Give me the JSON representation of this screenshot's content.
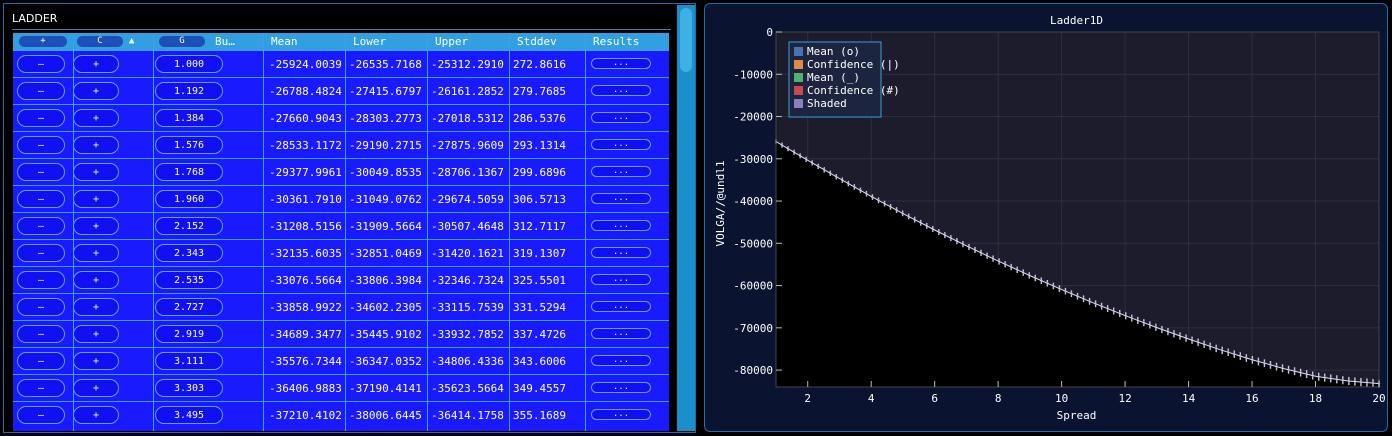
{
  "ladder": {
    "title": "LADDER",
    "header": {
      "plus_btn": "+",
      "c_btn": "C",
      "sort_arrow": "▲",
      "g_btn": "G",
      "bump_label": "Bu…",
      "columns": [
        "Mean",
        "Lower",
        "Upper",
        "Stddev",
        "Results"
      ]
    },
    "minus_label": "–",
    "plus_label": "+",
    "results_label": "...",
    "rows": [
      {
        "bump": "1.000",
        "mean": "-25924.0039",
        "lower": "-26535.7168",
        "upper": "-25312.2910",
        "stddev": "272.8616"
      },
      {
        "bump": "1.192",
        "mean": "-26788.4824",
        "lower": "-27415.6797",
        "upper": "-26161.2852",
        "stddev": "279.7685"
      },
      {
        "bump": "1.384",
        "mean": "-27660.9043",
        "lower": "-28303.2773",
        "upper": "-27018.5312",
        "stddev": "286.5376"
      },
      {
        "bump": "1.576",
        "mean": "-28533.1172",
        "lower": "-29190.2715",
        "upper": "-27875.9609",
        "stddev": "293.1314"
      },
      {
        "bump": "1.768",
        "mean": "-29377.9961",
        "lower": "-30049.8535",
        "upper": "-28706.1367",
        "stddev": "299.6896"
      },
      {
        "bump": "1.960",
        "mean": "-30361.7910",
        "lower": "-31049.0762",
        "upper": "-29674.5059",
        "stddev": "306.5713"
      },
      {
        "bump": "2.152",
        "mean": "-31208.5156",
        "lower": "-31909.5664",
        "upper": "-30507.4648",
        "stddev": "312.7117"
      },
      {
        "bump": "2.343",
        "mean": "-32135.6035",
        "lower": "-32851.0469",
        "upper": "-31420.1621",
        "stddev": "319.1307"
      },
      {
        "bump": "2.535",
        "mean": "-33076.5664",
        "lower": "-33806.3984",
        "upper": "-32346.7324",
        "stddev": "325.5501"
      },
      {
        "bump": "2.727",
        "mean": "-33858.9922",
        "lower": "-34602.2305",
        "upper": "-33115.7539",
        "stddev": "331.5294"
      },
      {
        "bump": "2.919",
        "mean": "-34689.3477",
        "lower": "-35445.9102",
        "upper": "-33932.7852",
        "stddev": "337.4726"
      },
      {
        "bump": "3.111",
        "mean": "-35576.7344",
        "lower": "-36347.0352",
        "upper": "-34806.4336",
        "stddev": "343.6006"
      },
      {
        "bump": "3.303",
        "mean": "-36406.9883",
        "lower": "-37190.4141",
        "upper": "-35623.5664",
        "stddev": "349.4557"
      },
      {
        "bump": "3.495",
        "mean": "-37210.4102",
        "lower": "-38006.6445",
        "upper": "-36414.1758",
        "stddev": "355.1689"
      }
    ]
  },
  "chart_data": {
    "type": "line",
    "title": "Ladder1D",
    "xlabel": "Spread",
    "ylabel": "VOLGA//@undl1",
    "xlim": [
      1,
      20
    ],
    "ylim": [
      -84000,
      0
    ],
    "x_ticks": [
      2,
      4,
      6,
      8,
      10,
      12,
      14,
      16,
      18,
      20
    ],
    "y_ticks": [
      0,
      -10000,
      -20000,
      -30000,
      -40000,
      -50000,
      -60000,
      -70000,
      -80000
    ],
    "legend": [
      "Mean (o)",
      "Confidence (|)",
      "Mean (_)",
      "Confidence (#)",
      "Shaded"
    ],
    "legend_colors": [
      "#4a72b0",
      "#e08a4a",
      "#4fb070",
      "#c84a4a",
      "#8a7fc0"
    ],
    "legend_position": "top-left",
    "grid": true,
    "series": [
      {
        "name": "Mean (o)",
        "x": [
          1,
          2,
          3,
          4,
          5,
          6,
          7,
          8,
          9,
          10,
          11,
          12,
          13,
          14,
          15,
          16,
          17,
          18,
          19,
          20
        ],
        "y": [
          -25924,
          -30362,
          -34689,
          -38900,
          -42950,
          -46850,
          -50600,
          -54200,
          -57650,
          -60950,
          -64100,
          -67100,
          -69950,
          -72650,
          -75200,
          -77550,
          -79650,
          -81450,
          -82550,
          -83200
        ]
      }
    ],
    "stddev_range": [
      272.9,
      450
    ]
  }
}
